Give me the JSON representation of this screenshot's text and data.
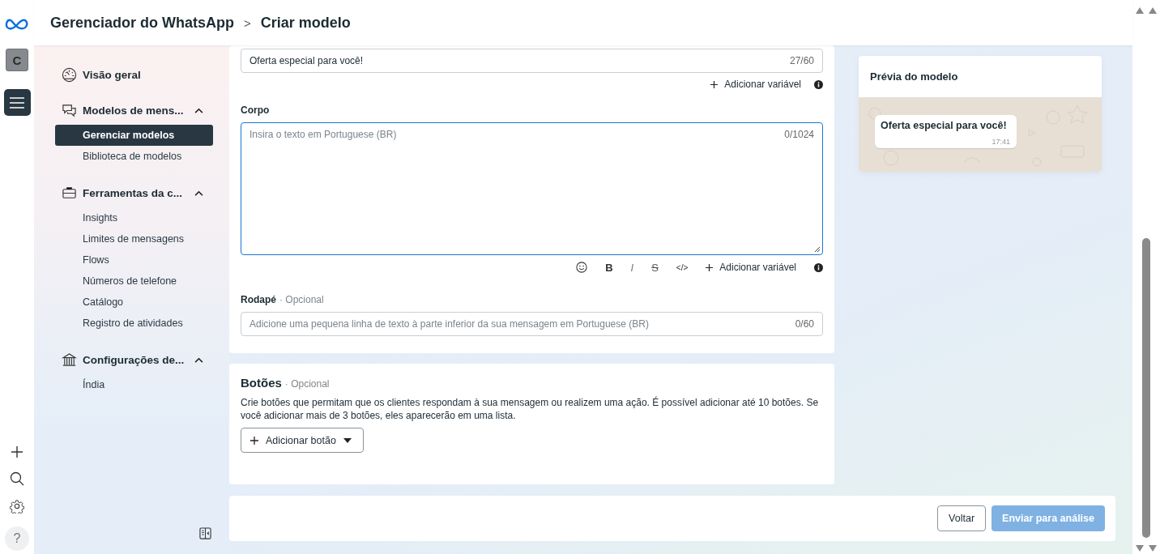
{
  "rail": {
    "avatar": "C",
    "help": "?"
  },
  "header": {
    "app": "Gerenciador do WhatsApp",
    "separator": ">",
    "page": "Criar modelo"
  },
  "sidebar": {
    "sections": [
      {
        "kind": "gauge",
        "label": "Visão geral"
      },
      {
        "kind": "chat",
        "label": "Modelos de mens...",
        "expanded": true,
        "children": [
          {
            "label": "Gerenciar modelos",
            "selected": true
          },
          {
            "label": "Biblioteca de modelos",
            "selected": false
          }
        ]
      },
      {
        "kind": "briefcase",
        "label": "Ferramentas da c...",
        "expanded": true,
        "children": [
          {
            "label": "Insights",
            "selected": false
          },
          {
            "label": "Limites de mensagens",
            "selected": false
          },
          {
            "label": "Flows",
            "selected": false
          },
          {
            "label": "Números de telefone",
            "selected": false
          },
          {
            "label": "Catálogo",
            "selected": false
          },
          {
            "label": "Registro de atividades",
            "selected": false
          }
        ]
      },
      {
        "kind": "bank",
        "label": "Configurações de...",
        "expanded": true,
        "children": [
          {
            "label": "Índia",
            "selected": false
          }
        ]
      }
    ]
  },
  "header_field": {
    "value": "Oferta especial para você!",
    "counter": "27/60",
    "add_variable": "Adicionar variável"
  },
  "body": {
    "label": "Corpo",
    "placeholder": "Insira o texto em Portuguese (BR)",
    "counter": "0/1024",
    "format_buttons": [
      {
        "kind": "bold",
        "label": "B"
      },
      {
        "kind": "italic",
        "label": "I"
      },
      {
        "kind": "strike",
        "label": "S"
      },
      {
        "kind": "code",
        "label": "</>"
      }
    ],
    "add_variable": "Adicionar variável"
  },
  "footer": {
    "label": "Rodapé",
    "optional": "· Opcional",
    "placeholder": "Adicione uma pequena linha de texto à parte inferior da sua mensagem em Portuguese (BR)",
    "counter": "0/60"
  },
  "buttons_section": {
    "title": "Botões",
    "optional": "· Opcional",
    "description": "Crie botões que permitam que os clientes respondam à sua mensagem ou realizem uma ação. É possível adicionar até 10 botões. Se você adicionar mais de 3 botões, eles aparecerão em uma lista.",
    "add_button": "Adicionar botão"
  },
  "actions": [
    {
      "label": "Voltar",
      "disabled": false
    },
    {
      "label": "Enviar para análise",
      "disabled": true
    }
  ],
  "preview": {
    "title": "Prévia do modelo",
    "message": "Oferta especial para você!",
    "time": "17:41"
  }
}
